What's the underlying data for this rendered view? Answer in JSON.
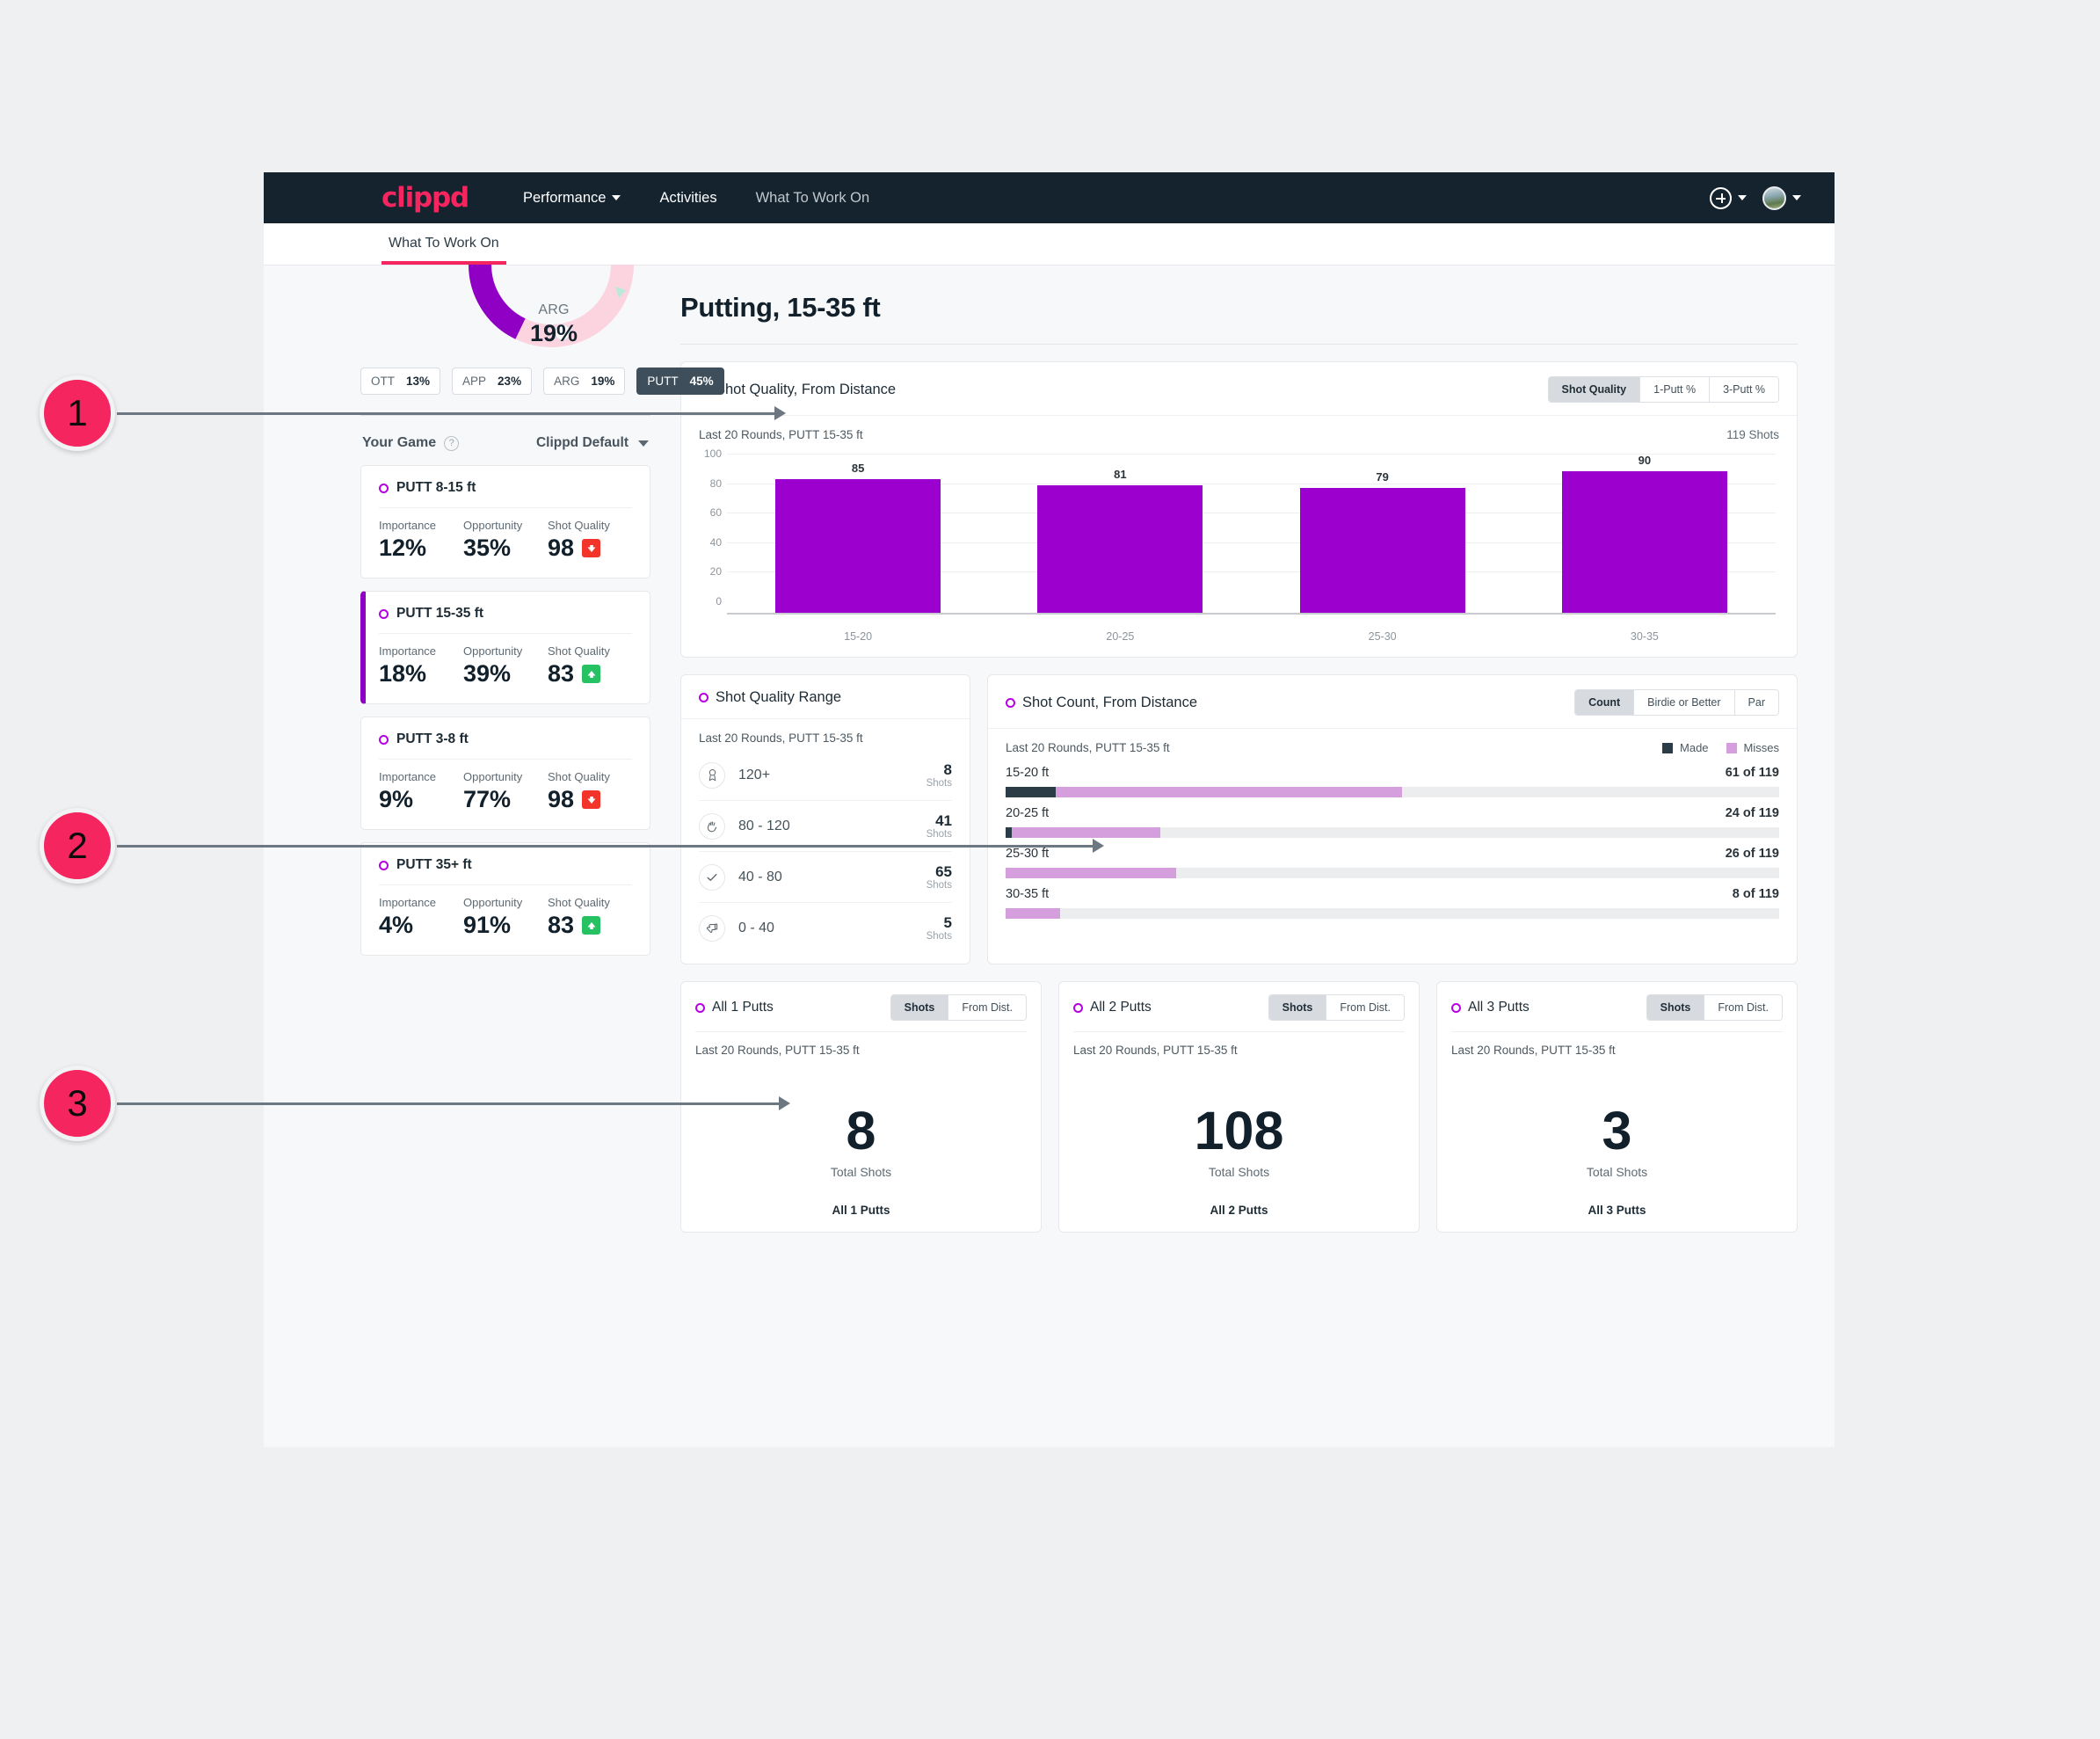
{
  "nav": {
    "brand": "clippd",
    "links": [
      {
        "label": "Performance",
        "caret": true,
        "muted": false
      },
      {
        "label": "Activities",
        "caret": false,
        "muted": false
      },
      {
        "label": "What To Work On",
        "caret": false,
        "muted": true
      }
    ],
    "add_icon": "plus-circle-icon",
    "avatar_icon": "user-avatar",
    "subtab": "What To Work On"
  },
  "sidebar": {
    "arc": {
      "label": "ARG",
      "value": "19%"
    },
    "pills": [
      {
        "label": "OTT",
        "value": "13%",
        "active": false
      },
      {
        "label": "APP",
        "value": "23%",
        "active": false
      },
      {
        "label": "ARG",
        "value": "19%",
        "active": false
      },
      {
        "label": "PUTT",
        "value": "45%",
        "active": true
      }
    ],
    "your_game_label": "Your Game",
    "help_icon": "question-mark-icon",
    "preset": "Clippd Default",
    "col_headers": [
      "Importance",
      "Opportunity",
      "Shot Quality"
    ],
    "cards": [
      {
        "title": "PUTT 8-15 ft",
        "importance": "12%",
        "opportunity": "35%",
        "quality": "98",
        "trend": "down",
        "selected": false
      },
      {
        "title": "PUTT 15-35 ft",
        "importance": "18%",
        "opportunity": "39%",
        "quality": "83",
        "trend": "up",
        "selected": true
      },
      {
        "title": "PUTT 3-8 ft",
        "importance": "9%",
        "opportunity": "77%",
        "quality": "98",
        "trend": "down",
        "selected": false
      },
      {
        "title": "PUTT 35+ ft",
        "importance": "4%",
        "opportunity": "91%",
        "quality": "83",
        "trend": "up",
        "selected": false
      }
    ]
  },
  "main": {
    "page_title": "Putting, 15-35 ft",
    "shot_quality_card": {
      "title": "Shot Quality, From Distance",
      "tabs": [
        {
          "label": "Shot Quality",
          "active": true
        },
        {
          "label": "1-Putt %",
          "active": false
        },
        {
          "label": "3-Putt %",
          "active": false
        }
      ],
      "subtitle": "Last 20 Rounds, PUTT 15-35 ft",
      "count": "119 Shots"
    },
    "quality_range_card": {
      "title": "Shot Quality Range",
      "subtitle": "Last 20 Rounds, PUTT 15-35 ft",
      "shots_word": "Shots",
      "rows": [
        {
          "icon": "trophy-icon",
          "range": "120+",
          "shots": "8"
        },
        {
          "icon": "clapping-hands-icon",
          "range": "80 - 120",
          "shots": "41"
        },
        {
          "icon": "check-icon",
          "range": "40 - 80",
          "shots": "65"
        },
        {
          "icon": "thumbs-down-icon",
          "range": "0 - 40",
          "shots": "5"
        }
      ]
    },
    "shot_count_card": {
      "title": "Shot Count, From Distance",
      "tabs": [
        {
          "label": "Count",
          "active": true
        },
        {
          "label": "Birdie or Better",
          "active": false
        },
        {
          "label": "Par",
          "active": false
        }
      ],
      "subtitle": "Last 20 Rounds, PUTT 15-35 ft",
      "legend": [
        {
          "label": "Made",
          "color": "#2b3c47"
        },
        {
          "label": "Misses",
          "color": "#d59fdd"
        }
      ],
      "rows": [
        {
          "label": "15-20 ft",
          "value": "61 of 119",
          "made_pct": 6.5,
          "miss_pct": 44.7
        },
        {
          "label": "20-25 ft",
          "value": "24 of 119",
          "made_pct": 0.8,
          "miss_pct": 19.2
        },
        {
          "label": "25-30 ft",
          "value": "26 of 119",
          "made_pct": 0,
          "miss_pct": 22.0
        },
        {
          "label": "30-35 ft",
          "value": "8 of 119",
          "made_pct": 0,
          "miss_pct": 7.0
        }
      ]
    },
    "putt_cards": [
      {
        "title": "All 1 Putts",
        "tabs": [
          {
            "label": "Shots",
            "active": true
          },
          {
            "label": "From Dist.",
            "active": false
          }
        ],
        "subtitle": "Last 20 Rounds, PUTT 15-35 ft",
        "big": "8",
        "big_label": "Total Shots",
        "footer": "All 1 Putts"
      },
      {
        "title": "All 2 Putts",
        "tabs": [
          {
            "label": "Shots",
            "active": true
          },
          {
            "label": "From Dist.",
            "active": false
          }
        ],
        "subtitle": "Last 20 Rounds, PUTT 15-35 ft",
        "big": "108",
        "big_label": "Total Shots",
        "footer": "All 2 Putts"
      },
      {
        "title": "All 3 Putts",
        "tabs": [
          {
            "label": "Shots",
            "active": true
          },
          {
            "label": "From Dist.",
            "active": false
          }
        ],
        "subtitle": "Last 20 Rounds, PUTT 15-35 ft",
        "big": "3",
        "big_label": "Total Shots",
        "footer": "All 3 Putts"
      }
    ]
  },
  "callouts": [
    {
      "number": "1"
    },
    {
      "number": "2"
    },
    {
      "number": "3"
    }
  ],
  "colors": {
    "accent_pink": "#f5255f",
    "bar_purple": "#9c00cf",
    "nav_dark": "#14232e",
    "made": "#2b3c47",
    "misses": "#d59fdd",
    "trend_up": "#25c162",
    "trend_down": "#f2342a"
  },
  "chart_data": {
    "type": "bar",
    "title": "Shot Quality, From Distance",
    "subtitle": "Last 20 Rounds, PUTT 15-35 ft",
    "categories": [
      "15-20",
      "20-25",
      "25-30",
      "30-35"
    ],
    "values": [
      85,
      81,
      79,
      90
    ],
    "xlabel": "",
    "ylabel": "",
    "ylim": [
      0,
      100
    ],
    "yticks": [
      0,
      20,
      40,
      60,
      80,
      100
    ],
    "grid": true,
    "legend": "none",
    "series_color": "#9c00cf",
    "data_labels": true
  }
}
